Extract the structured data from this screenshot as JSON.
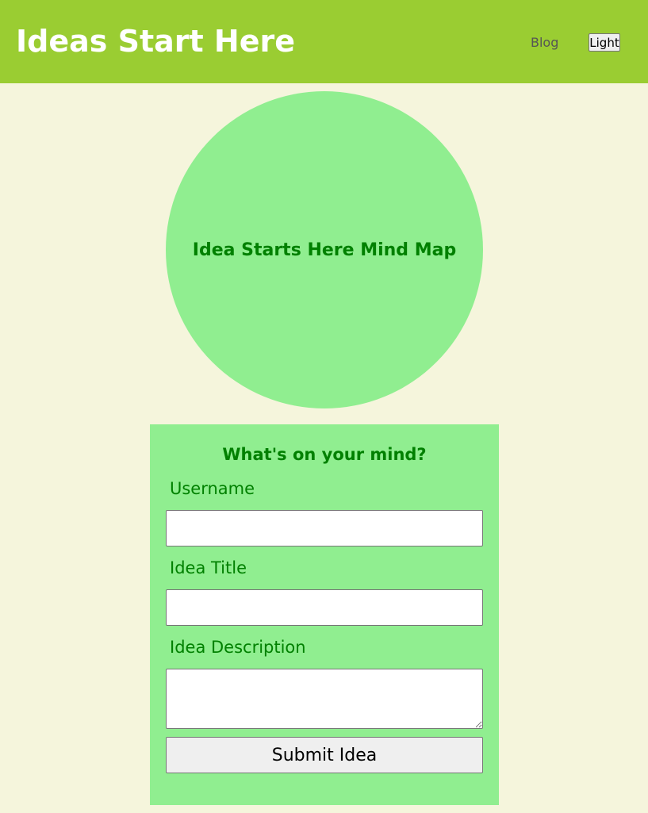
{
  "header": {
    "title": "Ideas Start Here",
    "nav": {
      "blog_label": "Blog",
      "theme_toggle_label": "Light"
    }
  },
  "mindmap": {
    "title": "Idea Starts Here Mind Map"
  },
  "idea_form": {
    "heading": "What's on your mind?",
    "username": {
      "label": "Username",
      "value": "",
      "placeholder": ""
    },
    "title": {
      "label": "Idea Title",
      "value": "",
      "placeholder": ""
    },
    "description": {
      "label": "Idea Description",
      "value": "",
      "placeholder": ""
    },
    "submit_label": "Submit Idea"
  },
  "colors": {
    "header_bg": "#9acd32",
    "page_bg": "#f5f5dc",
    "card_bg": "#90ee90",
    "accent_text": "#008000"
  }
}
